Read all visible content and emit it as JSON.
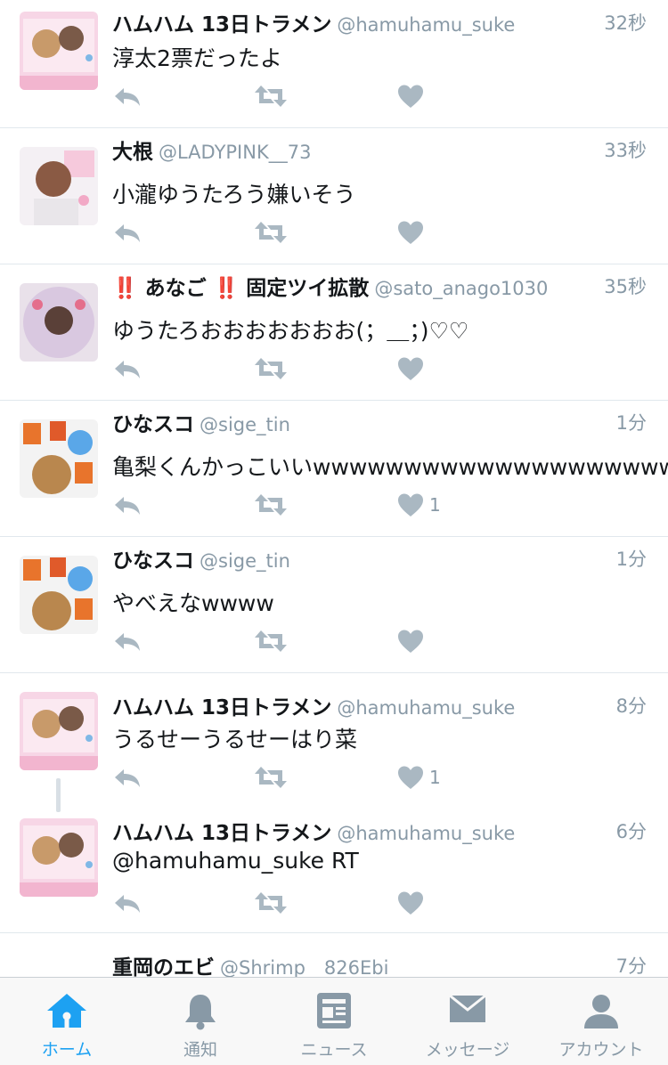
{
  "colors": {
    "accent": "#1da1f2",
    "muted": "#8899a6",
    "divider": "#e1e8ed"
  },
  "tweets": [
    {
      "name": "ハムハム 13日トラメン",
      "handle": "@hamuhamu_suke",
      "time": "32秒",
      "text": "淳太2票だったよ",
      "likes": ""
    },
    {
      "name": "大根",
      "handle": "@LADYPINK__73",
      "time": "33秒",
      "text": "小瀧ゆうたろう嫌いそう",
      "likes": ""
    },
    {
      "name": "‼️ あなご ‼️ 固定ツイ拡散",
      "handle": "@sato_anago1030",
      "time": "35秒",
      "text": "ゆうたろおおおおおおお(；＿；)♡♡",
      "likes": ""
    },
    {
      "name": "ひなスコ",
      "handle": "@sige_tin",
      "time": "1分",
      "text": "亀梨くんかっこいいwwwwwwwwwwwwwwwwwwww",
      "likes": "1"
    },
    {
      "name": "ひなスコ",
      "handle": "@sige_tin",
      "time": "1分",
      "text": "やべえなwwww",
      "likes": ""
    },
    {
      "name": "ハムハム 13日トラメン",
      "handle": "@hamuhamu_suke",
      "time": "8分",
      "text": "うるせーうるせーはり菜",
      "likes": "1"
    },
    {
      "name": "ハムハム 13日トラメン",
      "handle": "@hamuhamu_suke",
      "time": "6分",
      "text": "@hamuhamu_suke RT",
      "likes": ""
    },
    {
      "name": "重岡のエビ",
      "handle": "@Shrimp__826Ebi",
      "time": "7分",
      "text": "",
      "likes": ""
    }
  ],
  "tabbar": {
    "items": [
      {
        "label": "ホーム",
        "icon": "home-icon",
        "active": true
      },
      {
        "label": "通知",
        "icon": "bell-icon",
        "active": false
      },
      {
        "label": "ニュース",
        "icon": "news-icon",
        "active": false
      },
      {
        "label": "メッセージ",
        "icon": "envelope-icon",
        "active": false
      },
      {
        "label": "アカウント",
        "icon": "person-icon",
        "active": false
      }
    ]
  }
}
